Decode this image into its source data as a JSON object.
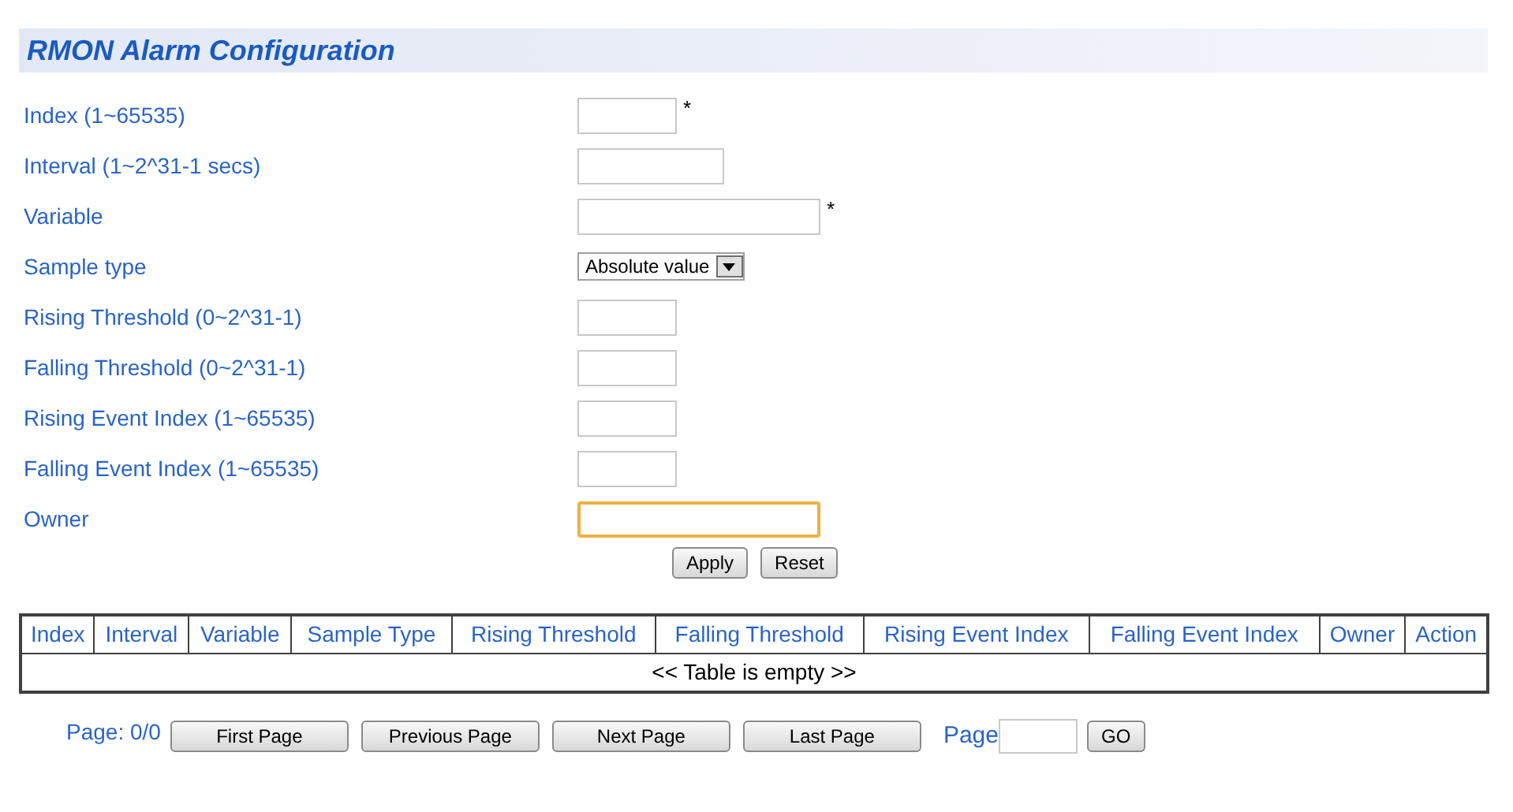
{
  "title": "RMON Alarm Configuration",
  "fields": [
    {
      "label": "Index (1~65535)",
      "kind": "short",
      "focused": false,
      "required_mark": "*"
    },
    {
      "label": "Interval (1~2^31-1 secs)",
      "kind": "medium",
      "focused": false
    },
    {
      "label": "Variable",
      "kind": "long",
      "focused": false,
      "required_mark": "*"
    },
    {
      "label": "Sample type",
      "kind": "select",
      "value": "Absolute value"
    },
    {
      "label": "Rising Threshold (0~2^31-1)",
      "kind": "short",
      "focused": false
    },
    {
      "label": "Falling Threshold (0~2^31-1)",
      "kind": "short",
      "focused": false
    },
    {
      "label": "Rising Event Index (1~65535)",
      "kind": "short",
      "focused": false
    },
    {
      "label": "Falling Event Index (1~65535)",
      "kind": "short",
      "focused": false
    },
    {
      "label": "Owner",
      "kind": "long",
      "focused": true
    }
  ],
  "form_buttons": [
    "Apply",
    "Reset"
  ],
  "table": {
    "columns": [
      "Index",
      "Interval",
      "Variable",
      "Sample Type",
      "Rising Threshold",
      "Falling Threshold",
      "Rising Event Index",
      "Falling Event Index",
      "Owner",
      "Action"
    ],
    "empty_message": "<< Table is empty >>"
  },
  "pagination": {
    "page_info": "Page: 0/0",
    "buttons": [
      "First Page",
      "Previous Page",
      "Next Page",
      "Last Page"
    ],
    "page_label": "Page",
    "go_button": "GO"
  }
}
